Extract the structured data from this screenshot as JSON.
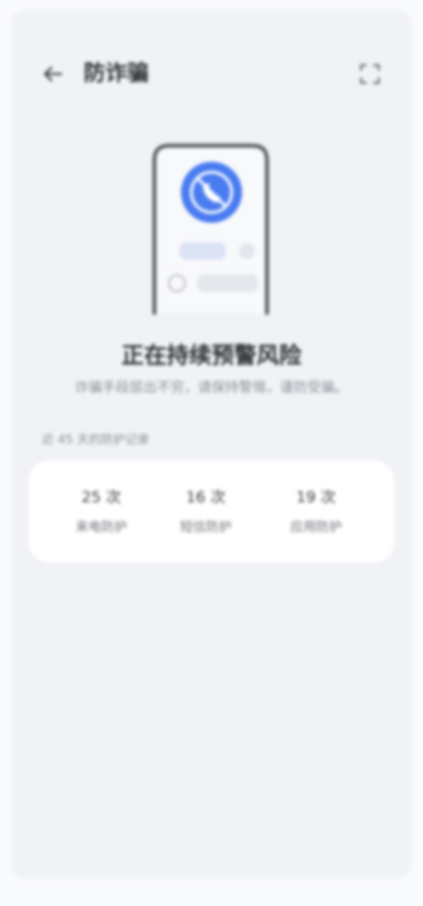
{
  "header": {
    "title": "防诈骗",
    "back_icon": "arrow-left-icon",
    "scan_icon": "scan-frame-icon"
  },
  "hero": {
    "icon": "no-call-shield-icon",
    "accent_color": "#4a7cf0",
    "title": "正在持续预警风险",
    "subtitle": "诈骗手段层出不穷，请保持警惕，谨防受骗。"
  },
  "stats_section": {
    "label": "近 45 天的防护记录",
    "items": [
      {
        "value": "25 次",
        "label": "来电防护"
      },
      {
        "value": "16 次",
        "label": "短信防护"
      },
      {
        "value": "19 次",
        "label": "应用防护"
      }
    ]
  }
}
